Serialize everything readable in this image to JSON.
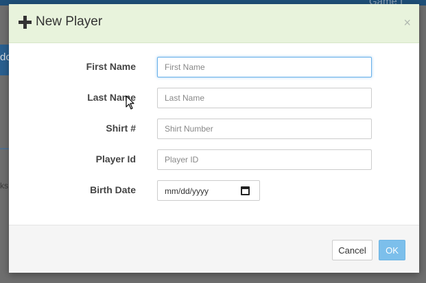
{
  "background": {
    "topbar_text": "Game I",
    "nav_text": "dc",
    "side_text": "ks"
  },
  "modal": {
    "title": "New Player",
    "close_symbol": "×",
    "fields": [
      {
        "label": "First Name",
        "placeholder": "First Name"
      },
      {
        "label": "Last Name",
        "placeholder": "Last Name"
      },
      {
        "label": "Shirt #",
        "placeholder": "Shirt Number"
      },
      {
        "label": "Player Id",
        "placeholder": "Player ID"
      },
      {
        "label": "Birth Date",
        "placeholder": "mm/dd/yyyy"
      }
    ],
    "cancel_label": "Cancel",
    "ok_label": "OK"
  },
  "icons": {
    "title_icon": "plus-icon",
    "date_icon": "calendar-icon"
  },
  "colors": {
    "header_bg": "#e8f3dc",
    "ok_button": "#7cbfeb",
    "focus_border": "#66afe9"
  }
}
